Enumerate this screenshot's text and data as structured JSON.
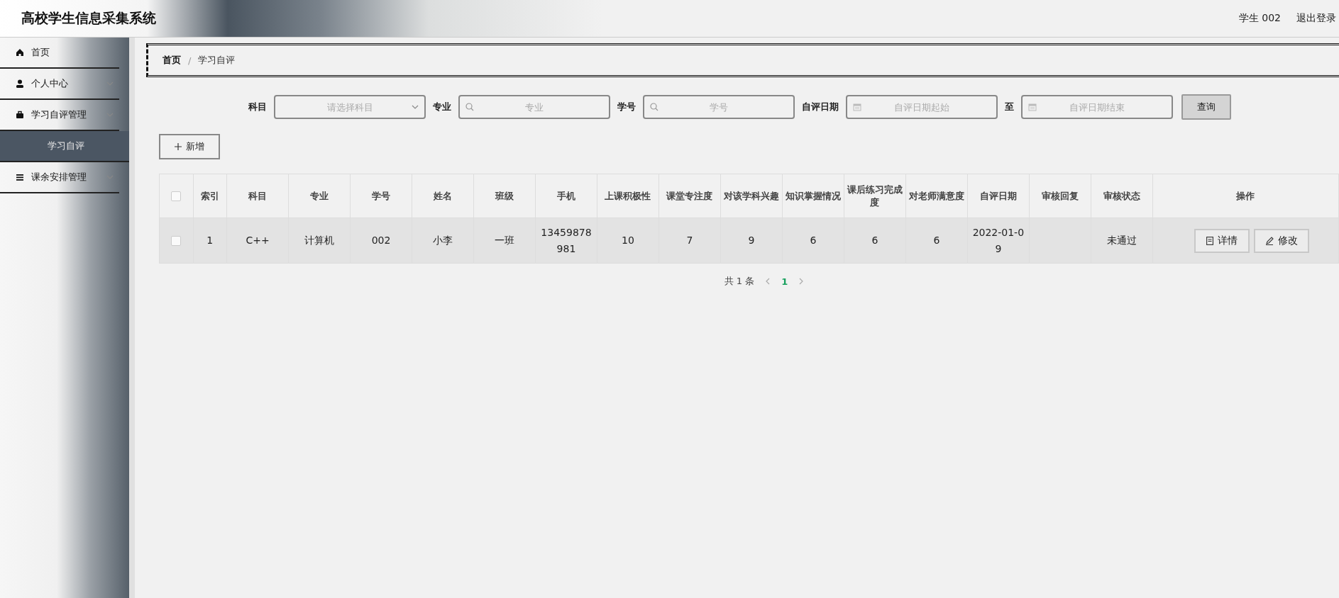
{
  "header": {
    "title": "高校学生信息采集系统",
    "user": "学生 002",
    "logout": "退出登录"
  },
  "sidebar": {
    "items": [
      {
        "label": "首页",
        "expandable": false
      },
      {
        "label": "个人中心",
        "expandable": true
      },
      {
        "label": "学习自评管理",
        "expandable": true,
        "children": [
          {
            "label": "学习自评",
            "selected": true
          }
        ]
      },
      {
        "label": "课余安排管理",
        "expandable": true
      }
    ]
  },
  "breadcrumb": [
    "首页",
    "学习自评"
  ],
  "breadcrumb_separator": "/",
  "search": {
    "fields": [
      {
        "kind": "select",
        "label": "科目",
        "placeholder": "请选择科目"
      },
      {
        "kind": "search",
        "label": "专业",
        "placeholder": "专业"
      },
      {
        "kind": "search",
        "label": "学号",
        "placeholder": "学号"
      },
      {
        "kind": "date",
        "label": "自评日期",
        "placeholder": "自评日期起始"
      },
      {
        "kind": "date",
        "label": "至",
        "placeholder": "自评日期结束"
      }
    ],
    "button": "查询"
  },
  "add_button": "新增",
  "table": {
    "columns": [
      "索引",
      "科目",
      "专业",
      "学号",
      "姓名",
      "班级",
      "手机",
      "上课积极性",
      "课堂专注度",
      "对该学科兴趣",
      "知识掌握情况",
      "课后练习完成度",
      "对老师满意度",
      "自评日期",
      "审核回复",
      "审核状态",
      "操作"
    ],
    "all_checked": false,
    "rows": [
      {
        "checked": false,
        "cells": [
          "1",
          "C++",
          "计算机",
          "002",
          "小李",
          "一班",
          "13459878981",
          "10",
          "7",
          "9",
          "6",
          "6",
          "6",
          "2022-01-09",
          "",
          "未通过"
        ],
        "actions": [
          {
            "kind": "detail",
            "label": "详情"
          },
          {
            "kind": "edit",
            "label": "修改"
          }
        ]
      }
    ]
  },
  "pagination": {
    "total": "共 1 条",
    "pages": [
      {
        "label": "1",
        "selected": true
      }
    ]
  }
}
